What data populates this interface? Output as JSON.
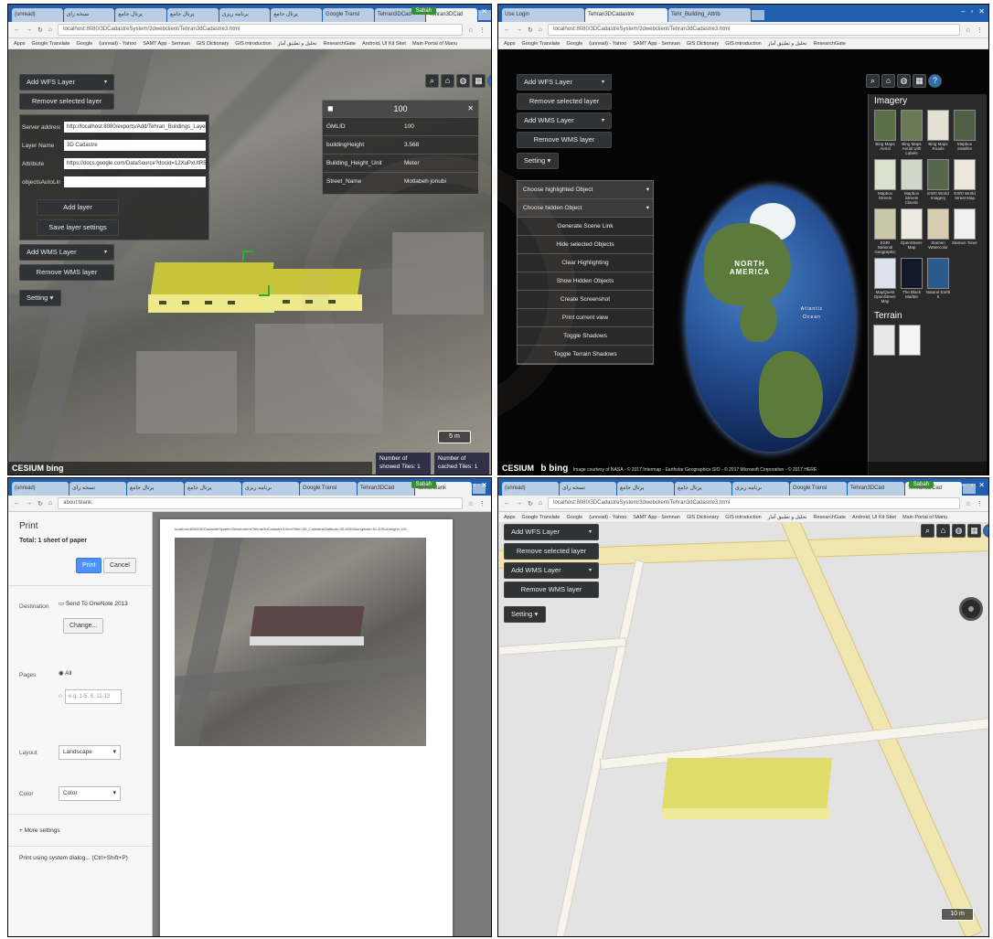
{
  "panel1": {
    "tabs": [
      "(unread)",
      "نسخه رای",
      "پرتال جامع",
      "پرتال جامع",
      "برنامه ریزی",
      "پرتال جامع",
      "Google Transl",
      "Tehran3DCad",
      "Tehran3DCad"
    ],
    "url": "localhost:8080/3DCadastreSystem/3dwebclient/Tehran3dCadastre3.html",
    "bookmarks": [
      "Apps",
      "Google Translate",
      "Google",
      "(unread) - Yahoo",
      "SAMT App - Semnan",
      "GIS Dictionary",
      "GIS introduction",
      "تحلیل و تطبیق آمار",
      "ResearchGate",
      "Android, UI Kit Sket",
      "Main Portal of Manu"
    ],
    "user": "Sabah",
    "add_wfs": "Add WFS Layer",
    "remove_selected": "Remove selected layer",
    "form": [
      {
        "label": "Server address",
        "value": "http://localhost:8080/exports/Add/Tehran_Buildings_Layer3_collada"
      },
      {
        "label": "Layer Name",
        "value": "3D Cadastre"
      },
      {
        "label": "Attribute",
        "value": "https://docs.google.com/DataSource?docid=12XuPxUtR5"
      },
      {
        "label": "objectsAutoLinkUrl",
        "value": ""
      }
    ],
    "add_layer": "Add layer",
    "save_settings": "Save layer settings",
    "add_wms": "Add WMS Layer",
    "remove_wms": "Remove WMS layer",
    "setting": "Setting",
    "info_title": "100",
    "info_rows": [
      [
        "GMLID",
        "100"
      ],
      [
        "buildingHeight",
        "3.568"
      ],
      [
        "Building_Height_Unit",
        "Meter"
      ],
      [
        "Street_Name",
        "Motlabeh jonubi"
      ]
    ],
    "scale": "5 m",
    "showed": "Number of showed Tiles: 1",
    "cached": "Number of cached Tiles: 1",
    "credit": "CESIUM bing"
  },
  "panel2": {
    "tabs": [
      "Use Login",
      "Tehran3DCadastre",
      "Tehr_Building_Attrib"
    ],
    "url": "localhost:8080/3DCadastreSystem/3dwebclient/Tehran3dCadastre3.html",
    "add_wfs": "Add WFS Layer",
    "remove_selected": "Remove selected layer",
    "add_wms": "Add WMS Layer",
    "remove_wms": "Remove WMS layer",
    "setting": "Setting",
    "menu": [
      "Choose highlighted Object",
      "Choose hidden Object",
      "Generate Scene Link",
      "Hide selected Objects",
      "Clear Highlighting",
      "Show Hidden Objects",
      "Create Screenshot",
      "Print current view",
      "Toggle Shadows",
      "Toggle Terrain Shadows"
    ],
    "globe_label": "NORTH AMERICA",
    "ocean_label": "Atlantic Ocean",
    "imagery_title": "Imagery",
    "imagery": [
      "Bing Maps Aerial",
      "Bing Maps Aerial with Labels",
      "Bing Maps Roads",
      "Mapbox Satellite",
      "Mapbox Streets",
      "Mapbox Streets Classic",
      "ESRI World Imagery",
      "ESRI World Street Map",
      "ESRI National Geographic",
      "OpenStreet-Map",
      "Stamen Watercolor",
      "Stamen Toner",
      "MapQuest OpenStreet-Map",
      "The Black Marble",
      "Natural Earth II"
    ],
    "terrain_title": "Terrain",
    "credit": "Image courtesy of NASA - © 2017 Intermap - Earthstar Geographics SIO - © 2017 Microsoft Corporation - © 2017 HERE"
  },
  "panel3": {
    "url": "about:blank",
    "print_title": "Print",
    "sheet_count": "Total: 1 sheet of paper",
    "print_btn": "Print",
    "cancel_btn": "Cancel",
    "destination_label": "Destination",
    "destination": "Send To OneNote 2013",
    "change_btn": "Change...",
    "pages_label": "Pages",
    "pages_all": "All",
    "pages_placeholder": "e.g. 1-5, 8, 11-13",
    "layout_label": "Layout",
    "layout": "Landscape",
    "color_label": "Color",
    "color": "Color",
    "more": "More settings",
    "system_dialog": "Print using system dialog... (Ctrl+Shift+P)",
    "page_url": "localhost:8080/3DCadastreSystem/3dwebclient/Tehran3dCadastre3.html?title=3D_Cadastre&latitude=35.6939&longitude=51.4091&height=120"
  },
  "panel4": {
    "url": "localhost:8080/3DCadastreSystem/3dwebclient/Tehran3dCadastre3.html",
    "add_wfs": "Add WFS Layer",
    "remove_selected": "Remove selected layer",
    "add_wms": "Add WMS Layer",
    "remove_wms": "Remove WMS layer",
    "setting": "Setting",
    "scale": "10 m"
  },
  "colors": {
    "building_top": "#c9c53a",
    "building_side": "#eee98a",
    "cesium_panel": "#303336",
    "print_blue": "#4d90fe"
  }
}
